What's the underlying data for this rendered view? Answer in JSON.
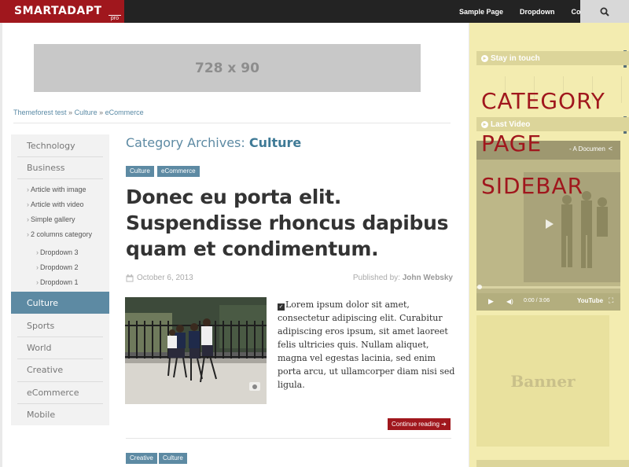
{
  "header": {
    "logo": "SMARTADAPT",
    "logo_badge": "pro",
    "nav": [
      "Sample Page",
      "Dropdown",
      "Contact"
    ],
    "search_icon": "search-icon"
  },
  "ad": {
    "leaderboard": "728 x 90"
  },
  "breadcrumb": {
    "items": [
      "Themeforest test",
      "Culture",
      "eCommerce"
    ],
    "separator": "»"
  },
  "categories": {
    "items": [
      "Technology",
      "Business",
      "Culture",
      "Sports",
      "World",
      "Creative",
      "eCommerce",
      "Mobile"
    ],
    "active": "Culture",
    "business_sub": [
      "Article with image",
      "Article with video",
      "Simple gallery",
      "2 columns category"
    ],
    "dropdowns": [
      "Dropdown 3",
      "Dropdown 2",
      "Dropdown 1"
    ]
  },
  "archive": {
    "prefix": "Category Archives:",
    "name": "Culture"
  },
  "post": {
    "tags": [
      "Culture",
      "eCommerce"
    ],
    "title": "Donec eu porta elit. Suspendisse rhoncus dapibus quam et condimentum.",
    "date": "October 6, 2013",
    "author_label": "Published by:",
    "author": "John Websky",
    "excerpt": "Lorem ipsum dolor sit amet, consectetur adipiscing elit. Curabitur adipiscing eros ipsum, sit amet laoreet felis ultricies quis. Nullam aliquet, magna vel egestas lacinia, sed enim porta arcu, ut ullamcorper diam nisi sed ligula.",
    "continue": "Continue reading"
  },
  "next_post": {
    "tags": [
      "Creative",
      "Culture"
    ]
  },
  "sidebar": {
    "stay_in_touch": "Stay in touch",
    "last_video": "Last Video",
    "video_title": "- A Documen",
    "video_time": "0:00 / 3:06",
    "video_brand": "YouTube",
    "banner": "Banner",
    "overlay_lines": [
      "CATEGORY",
      "PAGE",
      "SIDEBAR"
    ]
  },
  "colors": {
    "brand_red": "#a0171d",
    "accent_blue": "#5d8aa3",
    "sidebar_overlay": "#f3ecae"
  }
}
